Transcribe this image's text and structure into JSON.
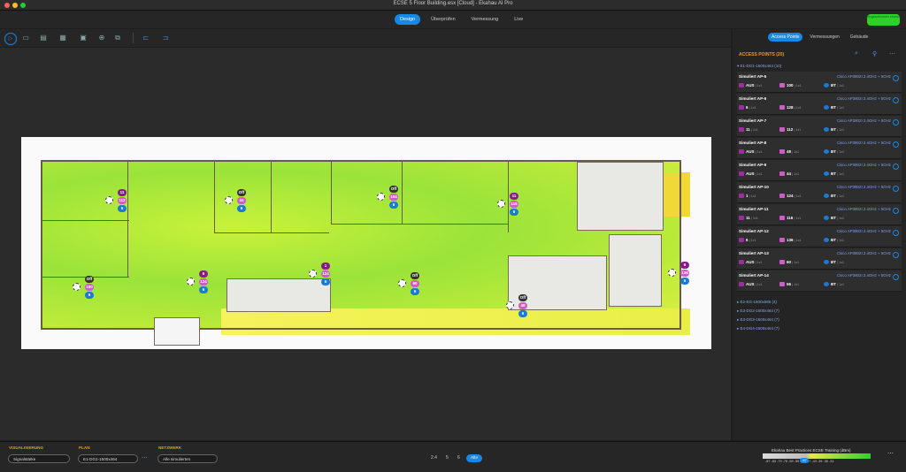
{
  "window": {
    "title": "ECSE 5 Floor Building.esx [Cloud] - Ekahau AI Pro"
  },
  "nav": {
    "tabs": [
      {
        "label": "Design",
        "active": true
      },
      {
        "label": "Überprüfen"
      },
      {
        "label": "Vermessung"
      },
      {
        "label": "Live"
      }
    ]
  },
  "cloud_status": "Angeschlossen erfasst",
  "toolbar": {
    "icons": [
      "select-icon",
      "window-icon",
      "comment-icon",
      "card-icon",
      "folder-icon",
      "target-icon",
      "export-icon",
      "ap-place-icon",
      "ap-auto-icon"
    ]
  },
  "right_panel": {
    "tabs": [
      "Access Points",
      "Vermessungen",
      "Gebäude"
    ],
    "section_title": "ACCESS POINTS (20)",
    "group_open": "E1-DG1-1500x464 (10)",
    "aps": [
      {
        "name": "Simuliert AP-5",
        "model": "Cisco AP3802I 2.4GHz + 5GHz",
        "a": "AUS",
        "b": "100",
        "c": "BT"
      },
      {
        "name": "Simuliert AP-6",
        "model": "Cisco AP3802I 2.4GHz + 5GHz",
        "a": "6",
        "b": "128",
        "c": "BT"
      },
      {
        "name": "Simuliert AP-7",
        "model": "Cisco AP3802I 2.4GHz + 5GHz",
        "a": "11",
        "b": "112",
        "c": "BT"
      },
      {
        "name": "Simuliert AP-8",
        "model": "Cisco AP3802I 2.4GHz + 5GHz",
        "a": "AUS",
        "b": "48",
        "c": "BT"
      },
      {
        "name": "Simuliert AP-9",
        "model": "Cisco AP3802I 2.4GHz + 5GHz",
        "a": "AUS",
        "b": "44",
        "c": "BT"
      },
      {
        "name": "Simuliert AP-10",
        "model": "Cisco AP3802I 2.4GHz + 5GHz",
        "a": "1",
        "b": "124",
        "c": "BT"
      },
      {
        "name": "Simuliert AP-11",
        "model": "Cisco AP3802I 2.4GHz + 5GHz",
        "a": "11",
        "b": "116",
        "c": "BT"
      },
      {
        "name": "Simuliert AP-12",
        "model": "Cisco AP3802I 2.4GHz + 5GHz",
        "a": "6",
        "b": "136",
        "c": "BT"
      },
      {
        "name": "Simuliert AP-13",
        "model": "Cisco AP3802I 2.4GHz + 5GHz",
        "a": "AUS",
        "b": "60",
        "c": "BT"
      },
      {
        "name": "Simuliert AP-14",
        "model": "Cisco AP3802I 2.4GHz + 5GHz",
        "a": "AUS",
        "b": "56",
        "c": "BT"
      }
    ],
    "collapsed_groups": [
      "E2-EG-1500x585 (4)",
      "E3-DG2-1500x464 (7)",
      "E3-DG3-1500x464 (7)",
      "E4-DG4-1500x464 (7)"
    ]
  },
  "plan_aps": [
    {
      "top": "11",
      "mid": "112",
      "bot": "6"
    },
    {
      "top": "Off",
      "mid": "44",
      "bot": "6"
    },
    {
      "top": "Off",
      "mid": "104",
      "bot": "6"
    },
    {
      "top": "11",
      "mid": "116",
      "bot": "6"
    },
    {
      "top": "6",
      "mid": "124",
      "bot": "6"
    },
    {
      "top": "Off",
      "mid": "100",
      "bot": "6"
    },
    {
      "top": "1",
      "mid": "124",
      "bot": "6"
    },
    {
      "top": "Off",
      "mid": "60",
      "bot": "6"
    },
    {
      "top": "Off",
      "mid": "48",
      "bot": "6"
    },
    {
      "top": "6",
      "mid": "136",
      "bot": "6"
    }
  ],
  "bottom": {
    "vis_label": "VISUALISIERUNG",
    "vis_value": "Signalstärke",
    "plan_label": "PLAN",
    "plan_value": "E1-DG1-1500x464",
    "net_label": "NETZWERK",
    "net_value": "Alle simulierten",
    "zoom": [
      "2.4",
      "5",
      "6"
    ],
    "zoom_all": "Alle",
    "legend_title": "Ekahau Best Practices ECSE Training (dBm)",
    "legend_ticks": "-87 -83 -79 -75          -59 -55 -51 -47 -43 -39 -35 -31",
    "legend_marker": "-67"
  }
}
